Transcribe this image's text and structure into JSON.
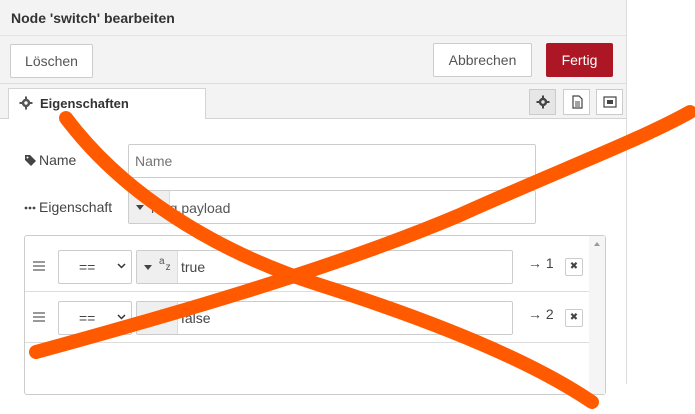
{
  "dialog": {
    "title": "Node 'switch' bearbeiten",
    "delete_label": "Löschen",
    "cancel_label": "Abbrechen",
    "done_label": "Fertig"
  },
  "tabs": {
    "active_label": "Eigenschaften",
    "icon_tabs": [
      "gear-icon",
      "description-icon",
      "appearance-icon"
    ]
  },
  "form": {
    "name_label": "Name",
    "name_placeholder": "Name",
    "name_value": "",
    "property_label": "Eigenschaft",
    "property_value": "msg.payload"
  },
  "rules": [
    {
      "operator": "==",
      "value_type_icon": "a-z",
      "value": "true",
      "output": "→ 1"
    },
    {
      "operator": "==",
      "value_type_icon": "a-z",
      "value": "false",
      "output": "→ 2"
    }
  ],
  "colors": {
    "primary_button": "#ad1625",
    "header_background": "#f3f3f3",
    "scribble_overlay": "#ff5a00"
  }
}
